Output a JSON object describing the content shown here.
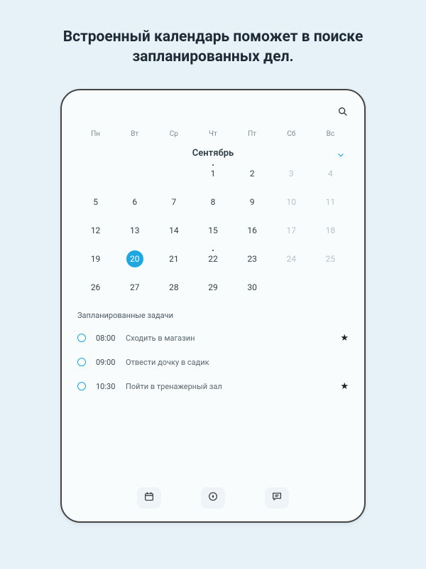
{
  "headline": "Встроенный календарь поможет в поиске запланированных дел.",
  "calendar": {
    "weekdays": [
      "Пн",
      "Вт",
      "Ср",
      "Чт",
      "Пт",
      "Сб",
      "Вс"
    ],
    "month": "Сентябрь",
    "cells": [
      {
        "n": ""
      },
      {
        "n": ""
      },
      {
        "n": ""
      },
      {
        "n": "1",
        "dot": true
      },
      {
        "n": "2"
      },
      {
        "n": "3",
        "dim": true
      },
      {
        "n": "4",
        "dim": true
      },
      {
        "n": "5"
      },
      {
        "n": "6"
      },
      {
        "n": "7"
      },
      {
        "n": "8"
      },
      {
        "n": "9"
      },
      {
        "n": "10",
        "dim": true
      },
      {
        "n": "11",
        "dim": true
      },
      {
        "n": "12"
      },
      {
        "n": "13"
      },
      {
        "n": "14"
      },
      {
        "n": "15"
      },
      {
        "n": "16"
      },
      {
        "n": "17",
        "dim": true
      },
      {
        "n": "18",
        "dim": true
      },
      {
        "n": "19"
      },
      {
        "n": "20",
        "sel": true
      },
      {
        "n": "21"
      },
      {
        "n": "22",
        "dot": true
      },
      {
        "n": "23"
      },
      {
        "n": "24",
        "dim": true
      },
      {
        "n": "25",
        "dim": true
      },
      {
        "n": "26"
      },
      {
        "n": "27"
      },
      {
        "n": "28"
      },
      {
        "n": "29"
      },
      {
        "n": "30"
      },
      {
        "n": ""
      },
      {
        "n": ""
      }
    ]
  },
  "tasks_title": "Запланированные задачи",
  "tasks": [
    {
      "time": "08:00",
      "text": "Сходить в магазин",
      "star": true
    },
    {
      "time": "09:00",
      "text": "Отвести дочку в садик",
      "star": false
    },
    {
      "time": "10:30",
      "text": "Пойти в тренажерный зал",
      "star": true
    }
  ]
}
